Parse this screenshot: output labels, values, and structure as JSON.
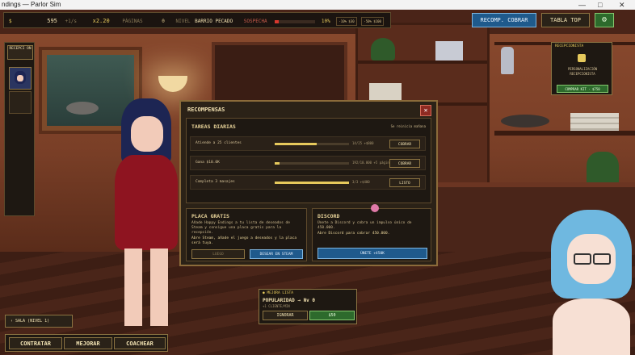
{
  "window": {
    "title": "ndings — Parlor Sim",
    "min": "—",
    "max": "□",
    "close": "✕"
  },
  "hud": {
    "money_icon": "$",
    "money": "595",
    "money_rate": "+1/s",
    "multiplier": "x2.20",
    "pages_label": "PÁGINAS",
    "pages": "0",
    "level_label": "NIVEL",
    "district": "BARRIO PECADO",
    "suspicion_label": "SOSPECHA",
    "suspicion_pct": "10%",
    "suspicion_level": 0.1,
    "suspicion_mod1": "-10% $30",
    "suspicion_mod2": "-50% $100",
    "btn_claim": "RECOMP. COBRAR",
    "btn_top": "TABLA TOP"
  },
  "sidebar": {
    "title": "RECEPCI ON"
  },
  "lock_panel": {
    "title": "RECEPCIONISTA",
    "text": "PERSONALIZACIÓN RECEPCIONISTA",
    "btn": "COMPRAR KIT · $750"
  },
  "modal": {
    "title": "RECOMPENSAS",
    "close": "✕",
    "daily": {
      "title": "TAREAS DIARIAS",
      "reset": "Se reinicia mañana",
      "tasks": [
        {
          "label": "Atiende a 25 clientes",
          "progress_text": "14/25 +$800",
          "btn": "COBRAR",
          "progress": 0.56
        },
        {
          "label": "Gana $10.0K",
          "progress_text": "192/10.000 +5 páginas",
          "btn": "COBRAR",
          "progress": 0.06
        },
        {
          "label": "Completa 3 masajes",
          "progress_text": "3/3 +$400",
          "btn": "LISTO",
          "progress": 1.0
        }
      ]
    },
    "placa": {
      "title": "PLACA GRATIS",
      "desc": "Añade Happy Endings a tu lista de deseados de Steam y consigue una placa gratis para la recepción.",
      "sub": "Abre Steam, añade el juego a deseados y la placa será tuya.",
      "btn_locked": "LUEGO",
      "btn_steam": "DESEAR EN STEAM"
    },
    "discord": {
      "title": "DISCORD",
      "desc": "Únete a Discord y cobra un impulso único de 450.000.",
      "sub": "Abre Discord para cobrar 450.000.",
      "btn": "ÚNETE +450K"
    }
  },
  "popup": {
    "tag": "MEJORA LISTA",
    "title": "POPULARIDAD → Nv 0",
    "sub": "+1 CLIENTE/MIN",
    "btn_ignore": "IGNORAR",
    "btn_buy": "$50"
  },
  "room": {
    "label": "‹ SALA (NIVEL 1)"
  },
  "bottom": {
    "hire": "CONTRATAR",
    "upgrade": "MEJORAR",
    "coach": "COACHEAR"
  }
}
